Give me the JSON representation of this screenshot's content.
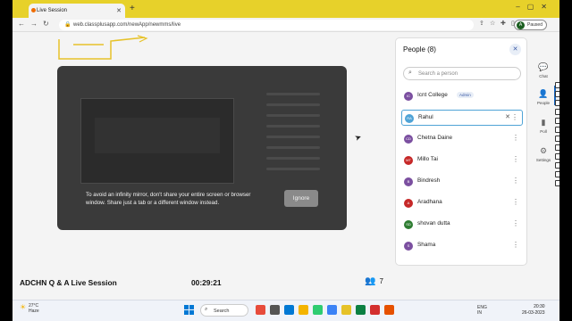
{
  "browser": {
    "tab_title": "Live Session",
    "url": "web.classplusapp.com/newApp/newmms/live",
    "profile_status": "Paused",
    "profile_initial": "A"
  },
  "dialog": {
    "message": "To avoid an infinity mirror, don't share your entire screen or browser window. Share just a tab or a different window instead.",
    "ignore_label": "Ignore"
  },
  "session": {
    "title": "ADCHN Q & A Live Session",
    "timer": "00:29:21",
    "participant_count": "7"
  },
  "people_panel": {
    "title": "People (8)",
    "search_placeholder": "Search a person",
    "people": [
      {
        "initials": "IC",
        "name": "Icnt College",
        "badge": "Admin",
        "color": "#7b4fa0"
      },
      {
        "initials": "RA",
        "name": "Rahul",
        "color": "#4fa3d6",
        "selected": true
      },
      {
        "initials": "CD",
        "name": "Chetna Daine",
        "color": "#7b4fa0"
      },
      {
        "initials": "MT",
        "name": "Millo Tai",
        "color": "#c62828"
      },
      {
        "initials": "B",
        "name": "Bindresh",
        "color": "#7b4fa0"
      },
      {
        "initials": "A",
        "name": "Aradhana",
        "color": "#c62828"
      },
      {
        "initials": "SD",
        "name": "shovan dutta",
        "color": "#2e7d32"
      },
      {
        "initials": "S",
        "name": "Shama",
        "color": "#7b4fa0"
      }
    ]
  },
  "rail": {
    "chat_label": "Chat",
    "people_label": "People",
    "poll_label": "Poll",
    "settings_label": "Settings"
  },
  "taskbar": {
    "weather_temp": "27°C",
    "weather_desc": "Haze",
    "search_label": "Search",
    "lang": "ENG",
    "region": "IN",
    "time": "20:30",
    "date": "26-03-2023"
  }
}
